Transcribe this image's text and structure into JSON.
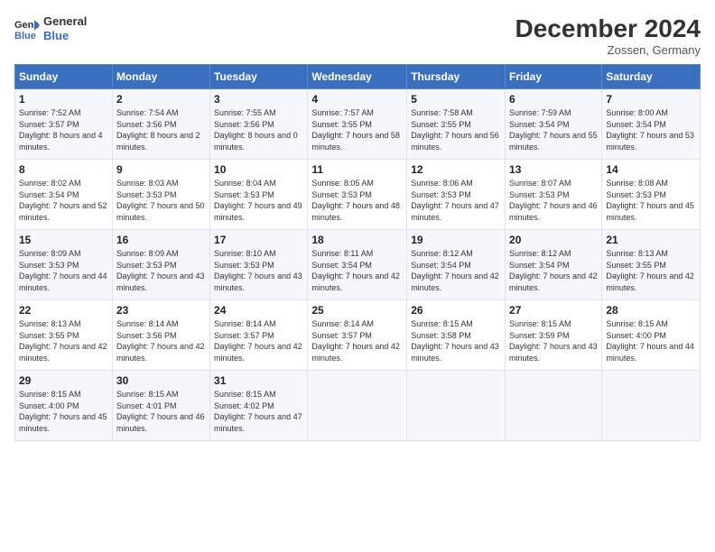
{
  "header": {
    "logo_line1": "General",
    "logo_line2": "Blue",
    "title": "December 2024",
    "subtitle": "Zossen, Germany"
  },
  "weekdays": [
    "Sunday",
    "Monday",
    "Tuesday",
    "Wednesday",
    "Thursday",
    "Friday",
    "Saturday"
  ],
  "weeks": [
    [
      {
        "day": "1",
        "rise": "Sunrise: 7:52 AM",
        "set": "Sunset: 3:57 PM",
        "daylight": "Daylight: 8 hours and 4 minutes."
      },
      {
        "day": "2",
        "rise": "Sunrise: 7:54 AM",
        "set": "Sunset: 3:56 PM",
        "daylight": "Daylight: 8 hours and 2 minutes."
      },
      {
        "day": "3",
        "rise": "Sunrise: 7:55 AM",
        "set": "Sunset: 3:56 PM",
        "daylight": "Daylight: 8 hours and 0 minutes."
      },
      {
        "day": "4",
        "rise": "Sunrise: 7:57 AM",
        "set": "Sunset: 3:55 PM",
        "daylight": "Daylight: 7 hours and 58 minutes."
      },
      {
        "day": "5",
        "rise": "Sunrise: 7:58 AM",
        "set": "Sunset: 3:55 PM",
        "daylight": "Daylight: 7 hours and 56 minutes."
      },
      {
        "day": "6",
        "rise": "Sunrise: 7:59 AM",
        "set": "Sunset: 3:54 PM",
        "daylight": "Daylight: 7 hours and 55 minutes."
      },
      {
        "day": "7",
        "rise": "Sunrise: 8:00 AM",
        "set": "Sunset: 3:54 PM",
        "daylight": "Daylight: 7 hours and 53 minutes."
      }
    ],
    [
      {
        "day": "8",
        "rise": "Sunrise: 8:02 AM",
        "set": "Sunset: 3:54 PM",
        "daylight": "Daylight: 7 hours and 52 minutes."
      },
      {
        "day": "9",
        "rise": "Sunrise: 8:03 AM",
        "set": "Sunset: 3:53 PM",
        "daylight": "Daylight: 7 hours and 50 minutes."
      },
      {
        "day": "10",
        "rise": "Sunrise: 8:04 AM",
        "set": "Sunset: 3:53 PM",
        "daylight": "Daylight: 7 hours and 49 minutes."
      },
      {
        "day": "11",
        "rise": "Sunrise: 8:05 AM",
        "set": "Sunset: 3:53 PM",
        "daylight": "Daylight: 7 hours and 48 minutes."
      },
      {
        "day": "12",
        "rise": "Sunrise: 8:06 AM",
        "set": "Sunset: 3:53 PM",
        "daylight": "Daylight: 7 hours and 47 minutes."
      },
      {
        "day": "13",
        "rise": "Sunrise: 8:07 AM",
        "set": "Sunset: 3:53 PM",
        "daylight": "Daylight: 7 hours and 46 minutes."
      },
      {
        "day": "14",
        "rise": "Sunrise: 8:08 AM",
        "set": "Sunset: 3:53 PM",
        "daylight": "Daylight: 7 hours and 45 minutes."
      }
    ],
    [
      {
        "day": "15",
        "rise": "Sunrise: 8:09 AM",
        "set": "Sunset: 3:53 PM",
        "daylight": "Daylight: 7 hours and 44 minutes."
      },
      {
        "day": "16",
        "rise": "Sunrise: 8:09 AM",
        "set": "Sunset: 3:53 PM",
        "daylight": "Daylight: 7 hours and 43 minutes."
      },
      {
        "day": "17",
        "rise": "Sunrise: 8:10 AM",
        "set": "Sunset: 3:53 PM",
        "daylight": "Daylight: 7 hours and 43 minutes."
      },
      {
        "day": "18",
        "rise": "Sunrise: 8:11 AM",
        "set": "Sunset: 3:54 PM",
        "daylight": "Daylight: 7 hours and 42 minutes."
      },
      {
        "day": "19",
        "rise": "Sunrise: 8:12 AM",
        "set": "Sunset: 3:54 PM",
        "daylight": "Daylight: 7 hours and 42 minutes."
      },
      {
        "day": "20",
        "rise": "Sunrise: 8:12 AM",
        "set": "Sunset: 3:54 PM",
        "daylight": "Daylight: 7 hours and 42 minutes."
      },
      {
        "day": "21",
        "rise": "Sunrise: 8:13 AM",
        "set": "Sunset: 3:55 PM",
        "daylight": "Daylight: 7 hours and 42 minutes."
      }
    ],
    [
      {
        "day": "22",
        "rise": "Sunrise: 8:13 AM",
        "set": "Sunset: 3:55 PM",
        "daylight": "Daylight: 7 hours and 42 minutes."
      },
      {
        "day": "23",
        "rise": "Sunrise: 8:14 AM",
        "set": "Sunset: 3:56 PM",
        "daylight": "Daylight: 7 hours and 42 minutes."
      },
      {
        "day": "24",
        "rise": "Sunrise: 8:14 AM",
        "set": "Sunset: 3:57 PM",
        "daylight": "Daylight: 7 hours and 42 minutes."
      },
      {
        "day": "25",
        "rise": "Sunrise: 8:14 AM",
        "set": "Sunset: 3:57 PM",
        "daylight": "Daylight: 7 hours and 42 minutes."
      },
      {
        "day": "26",
        "rise": "Sunrise: 8:15 AM",
        "set": "Sunset: 3:58 PM",
        "daylight": "Daylight: 7 hours and 43 minutes."
      },
      {
        "day": "27",
        "rise": "Sunrise: 8:15 AM",
        "set": "Sunset: 3:59 PM",
        "daylight": "Daylight: 7 hours and 43 minutes."
      },
      {
        "day": "28",
        "rise": "Sunrise: 8:15 AM",
        "set": "Sunset: 4:00 PM",
        "daylight": "Daylight: 7 hours and 44 minutes."
      }
    ],
    [
      {
        "day": "29",
        "rise": "Sunrise: 8:15 AM",
        "set": "Sunset: 4:00 PM",
        "daylight": "Daylight: 7 hours and 45 minutes."
      },
      {
        "day": "30",
        "rise": "Sunrise: 8:15 AM",
        "set": "Sunset: 4:01 PM",
        "daylight": "Daylight: 7 hours and 46 minutes."
      },
      {
        "day": "31",
        "rise": "Sunrise: 8:15 AM",
        "set": "Sunset: 4:02 PM",
        "daylight": "Daylight: 7 hours and 47 minutes."
      },
      null,
      null,
      null,
      null
    ]
  ]
}
